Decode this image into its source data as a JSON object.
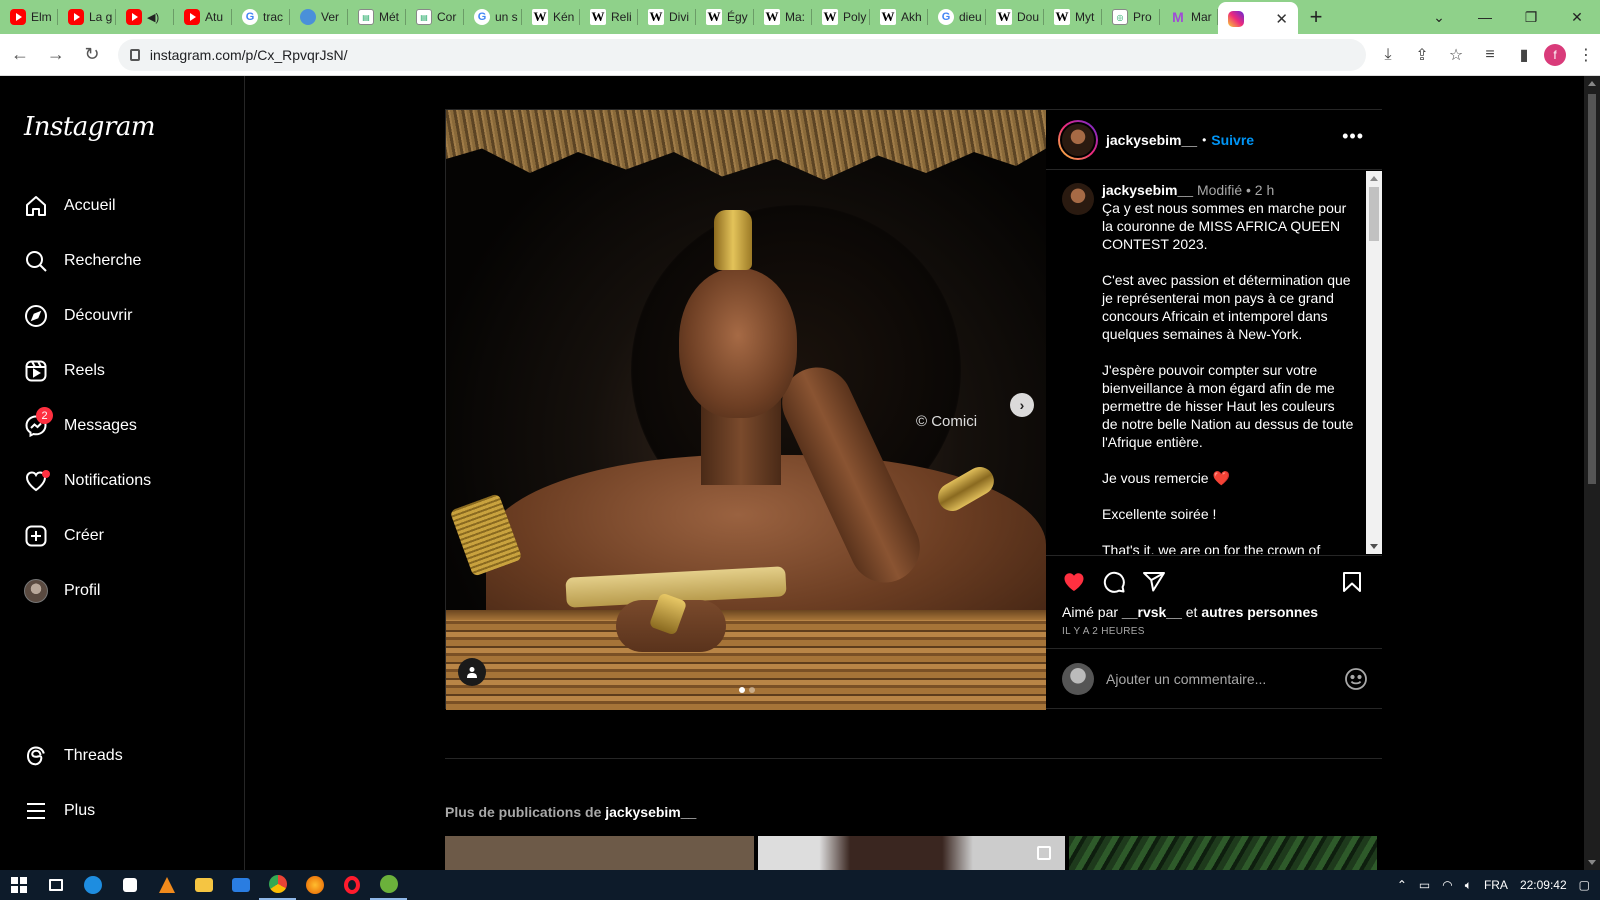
{
  "browser": {
    "tabs": [
      {
        "label": "Elm",
        "icon": "youtube-icon"
      },
      {
        "label": "La g",
        "icon": "youtube-icon"
      },
      {
        "label": "",
        "icon": "youtube-icon",
        "muted": true
      },
      {
        "label": "Atu",
        "icon": "youtube-icon"
      },
      {
        "label": "trac",
        "icon": "google-icon"
      },
      {
        "label": "Ver",
        "icon": "pin-icon"
      },
      {
        "label": "Mét",
        "icon": "doc-icon"
      },
      {
        "label": "Cor",
        "icon": "doc-icon"
      },
      {
        "label": "un s",
        "icon": "google-icon"
      },
      {
        "label": "Kén",
        "icon": "wikipedia-icon"
      },
      {
        "label": "Reli",
        "icon": "wikipedia-icon"
      },
      {
        "label": "Divi",
        "icon": "wikipedia-icon"
      },
      {
        "label": "Égy",
        "icon": "wikipedia-icon"
      },
      {
        "label": "Ma:",
        "icon": "wikipedia-icon"
      },
      {
        "label": "Poly",
        "icon": "wikipedia-icon"
      },
      {
        "label": "Akh",
        "icon": "wikipedia-icon"
      },
      {
        "label": "dieu",
        "icon": "google-icon"
      },
      {
        "label": "Dou",
        "icon": "wikipedia-icon"
      },
      {
        "label": "Myt",
        "icon": "wikipedia-icon"
      },
      {
        "label": "Pro",
        "icon": "doc-icon"
      },
      {
        "label": "Mar",
        "icon": "mu-icon"
      }
    ],
    "active_tab_icon": "instagram-icon",
    "new_tab": "+",
    "url": "instagram.com/p/Cx_RpvqrJsN/",
    "profile_initial": "f"
  },
  "sidebar": {
    "logo": "Instagram",
    "items": [
      {
        "label": "Accueil",
        "icon": "home-icon"
      },
      {
        "label": "Recherche",
        "icon": "search-icon"
      },
      {
        "label": "Découvrir",
        "icon": "compass-icon"
      },
      {
        "label": "Reels",
        "icon": "reels-icon"
      },
      {
        "label": "Messages",
        "icon": "messenger-icon",
        "badge": "2"
      },
      {
        "label": "Notifications",
        "icon": "heart-icon"
      },
      {
        "label": "Créer",
        "icon": "plus-square-icon"
      },
      {
        "label": "Profil",
        "icon": "avatar"
      }
    ],
    "bottom_items": [
      {
        "label": "Threads",
        "icon": "threads-icon"
      },
      {
        "label": "Plus",
        "icon": "menu-icon"
      }
    ]
  },
  "post": {
    "username": "jackysebim__",
    "separator": "•",
    "follow": "Suivre",
    "more": "•••",
    "watermark": "© Comici",
    "caption": {
      "username": "jackysebim__",
      "meta": "Modifié • 2 h",
      "paragraphs": [
        "Ça y est nous sommes en marche pour la couronne de MISS AFRICA QUEEN CONTEST 2023.",
        "C'est avec passion et détermination que je représenterai mon pays à ce grand concours Africain et intemporel dans quelques semaines à New-York.",
        "J'espère pouvoir compter sur votre bienveillance à mon égard afin de me permettre de hisser Haut les couleurs de notre belle Nation au dessus de toute l'Afrique entière.",
        "Je vous remercie ❤️",
        "Excellente soirée !",
        "That's it, we are on for the crown of"
      ]
    },
    "likes_prefix": "Aimé par",
    "likes_user": "__rvsk__",
    "likes_and": "et",
    "likes_others": "autres personnes",
    "time_ago": "IL Y A 2 HEURES",
    "comment_placeholder": "Ajouter un commentaire...",
    "liked": true,
    "carousel_index": 1,
    "carousel_count": 2
  },
  "more_posts": {
    "prefix": "Plus de publications de",
    "username": "jackysebim__"
  },
  "taskbar": {
    "language": "FRA",
    "clock": "22:09:42"
  },
  "colors": {
    "tabstrip": "#8fd18a",
    "link_blue": "#0095f6",
    "like_red": "#ff3040"
  }
}
